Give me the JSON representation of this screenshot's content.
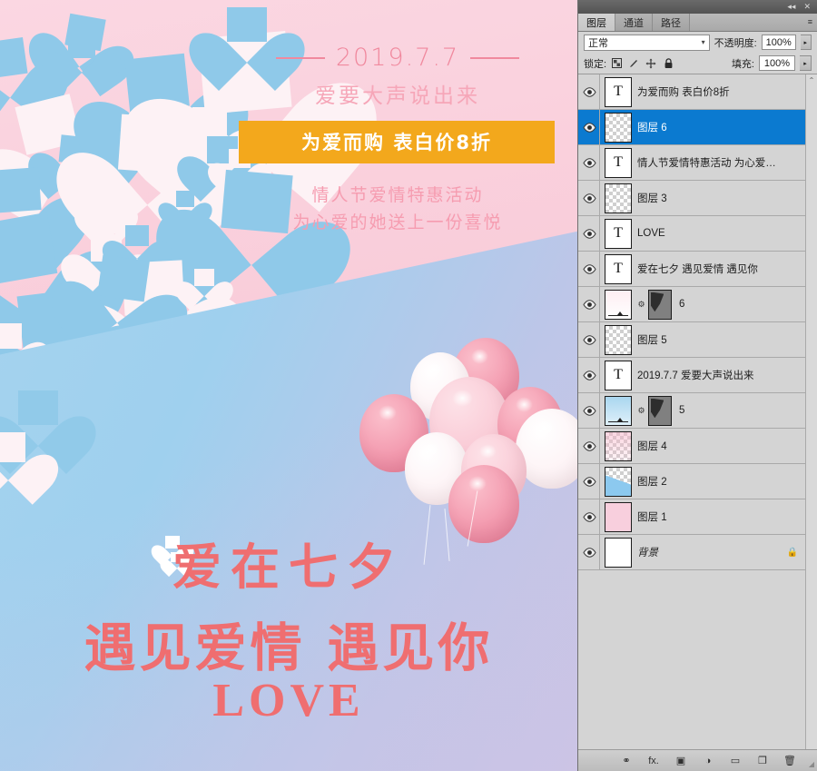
{
  "window": {
    "collapse_icon": "◂◂",
    "close_icon": "✕"
  },
  "panel": {
    "tabs": [
      {
        "label": "图层",
        "active": true
      },
      {
        "label": "通道",
        "active": false
      },
      {
        "label": "路径",
        "active": false
      }
    ],
    "menu_icon": "≡",
    "blend_mode": "正常",
    "opacity_label": "不透明度:",
    "opacity_value": "100%",
    "lock_label": "锁定:",
    "fill_label": "填充:",
    "fill_value": "100%",
    "lock_icons": [
      "transparency-lock-icon",
      "brush-lock-icon",
      "move-lock-icon",
      "all-lock-icon"
    ],
    "scrollbar_up": "⌃",
    "footer_buttons": [
      {
        "name": "link-layers-button",
        "glyph": "⚭"
      },
      {
        "name": "layer-style-button",
        "glyph": "fx."
      },
      {
        "name": "layer-mask-button",
        "glyph": "▣"
      },
      {
        "name": "adjustment-layer-button",
        "glyph": "◑"
      },
      {
        "name": "new-group-button",
        "glyph": "▭"
      },
      {
        "name": "new-layer-button",
        "glyph": "❐"
      },
      {
        "name": "delete-layer-button",
        "glyph": "🗑"
      }
    ],
    "layers": [
      {
        "name": "为爱而购 表白价8折",
        "type": "text",
        "selected": false,
        "visible": true,
        "has_mask": false,
        "locked": false
      },
      {
        "name": "图层 6",
        "type": "pixel",
        "selected": true,
        "visible": true,
        "has_mask": false,
        "locked": false
      },
      {
        "name": "情人节爱情特惠活动 为心爱…",
        "type": "text",
        "selected": false,
        "visible": true,
        "has_mask": false,
        "locked": false
      },
      {
        "name": "图层 3",
        "type": "pixel",
        "selected": false,
        "visible": true,
        "has_mask": false,
        "locked": false
      },
      {
        "name": "LOVE",
        "type": "text",
        "selected": false,
        "visible": true,
        "has_mask": false,
        "locked": false
      },
      {
        "name": "爱在七夕 遇见爱情 遇见你",
        "type": "text",
        "selected": false,
        "visible": true,
        "has_mask": false,
        "locked": false
      },
      {
        "name": "6",
        "type": "fill-pink",
        "selected": false,
        "visible": true,
        "has_mask": true,
        "locked": false
      },
      {
        "name": "图层 5",
        "type": "pixel",
        "selected": false,
        "visible": true,
        "has_mask": false,
        "locked": false
      },
      {
        "name": "2019.7.7 爱要大声说出来",
        "type": "text",
        "selected": false,
        "visible": true,
        "has_mask": false,
        "locked": false
      },
      {
        "name": "5",
        "type": "fill-blue",
        "selected": false,
        "visible": true,
        "has_mask": true,
        "locked": false
      },
      {
        "name": "图层 4",
        "type": "pixel-pink",
        "selected": false,
        "visible": true,
        "has_mask": false,
        "locked": false
      },
      {
        "name": "图层 2",
        "type": "pixel-blue",
        "selected": false,
        "visible": true,
        "has_mask": false,
        "locked": false
      },
      {
        "name": "图层 1",
        "type": "solid-pink",
        "selected": false,
        "visible": true,
        "has_mask": false,
        "locked": false
      },
      {
        "name": "背景",
        "type": "background",
        "selected": false,
        "visible": true,
        "has_mask": false,
        "locked": true
      }
    ]
  },
  "poster": {
    "date": "2019.7.7",
    "subtitle_top": "爱要大声说出来",
    "banner": "为爱而购  表白价8折",
    "promo_line1": "情人节爱情特惠活动",
    "promo_line2": "为心爱的她送上一份喜悦",
    "title_1": "爱在七夕",
    "title_2": "遇见爱情 遇见你",
    "title_3": "LOVE"
  },
  "colors": {
    "banner_orange": "#f3a81c",
    "title_red": "#ef6e70",
    "pink_bg": "#f9cdda",
    "blue_bg": "#a7d4ef",
    "heart_blue": "#8fc9e9",
    "selection_blue": "#0b7ad0"
  }
}
